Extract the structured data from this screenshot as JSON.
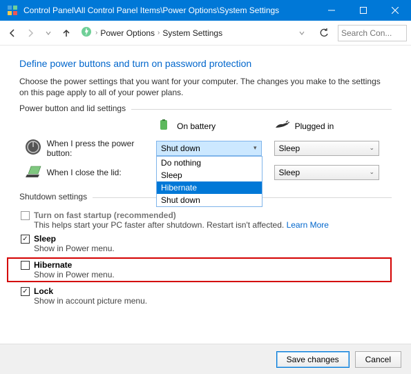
{
  "titlebar": {
    "path": "Control Panel\\All Control Panel Items\\Power Options\\System Settings"
  },
  "breadcrumb": {
    "b1": "Power Options",
    "b2": "System Settings"
  },
  "search": {
    "placeholder": "Search Con..."
  },
  "heading": "Define power buttons and turn on password protection",
  "subtext": "Choose the power settings that you want for your computer. The changes you make to the settings on this page apply to all of your power plans.",
  "group1": {
    "label": "Power button and lid settings",
    "battery_label": "On battery",
    "plugged_label": "Plugged in",
    "row1_label": "When I press the power button:",
    "row2_label": "When I close the lid:",
    "combo_open_value": "Shut down",
    "combo_sleep": "Sleep",
    "dropdown": {
      "o1": "Do nothing",
      "o2": "Sleep",
      "o3": "Hibernate",
      "o4": "Shut down"
    }
  },
  "group2": {
    "label": "Shutdown settings",
    "i1": {
      "title": "Turn on fast startup (recommended)",
      "desc": "This helps start your PC faster after shutdown. Restart isn't affected. ",
      "link": "Learn More"
    },
    "i2": {
      "title": "Sleep",
      "desc": "Show in Power menu."
    },
    "i3": {
      "title": "Hibernate",
      "desc": "Show in Power menu."
    },
    "i4": {
      "title": "Lock",
      "desc": "Show in account picture menu."
    }
  },
  "footer": {
    "save": "Save changes",
    "cancel": "Cancel"
  }
}
